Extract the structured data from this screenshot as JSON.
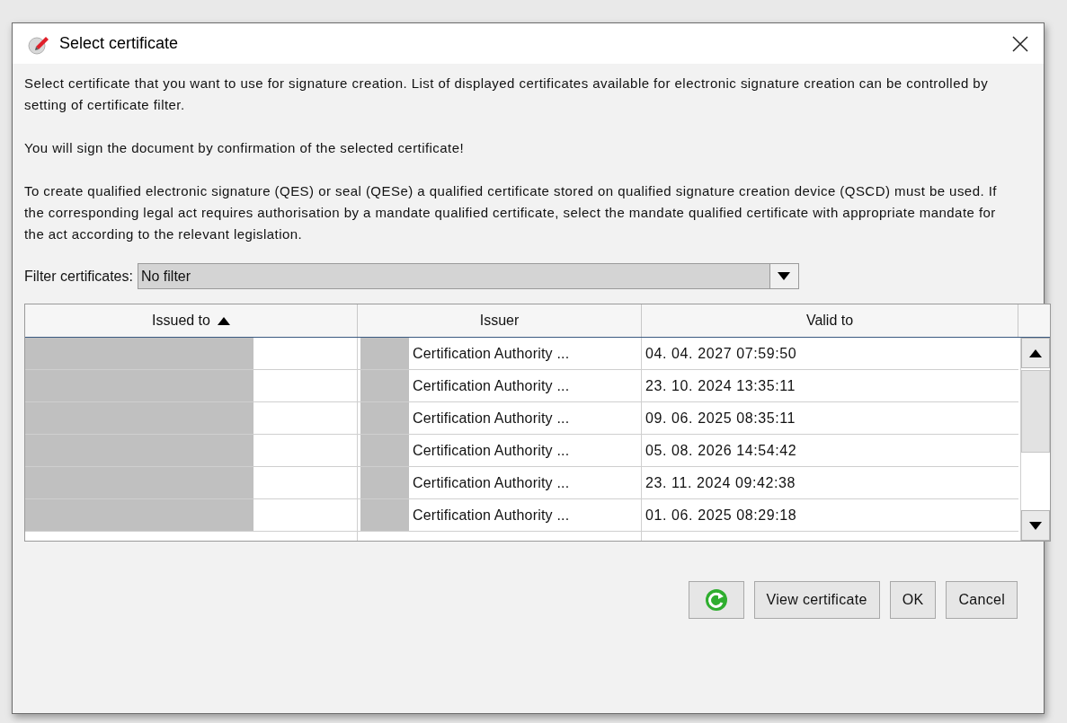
{
  "window": {
    "title": "Select certificate"
  },
  "intro": [
    "Select certificate that you want to use for signature creation. List of displayed certificates available for electronic signature creation can be controlled by setting of certificate filter.",
    "You will sign the document by confirmation of the selected certificate!",
    "To create qualified electronic signature (QES) or seal (QESe) a qualified certificate stored on qualified signature creation device (QSCD) must be used. If the corresponding legal act requires authorisation by a mandate qualified certificate, select the mandate qualified certificate with appropriate mandate for the act according to the relevant legislation."
  ],
  "filter": {
    "label": "Filter certificates:",
    "value": "No filter"
  },
  "table": {
    "columns": [
      {
        "label": "Issued to",
        "sorted": true
      },
      {
        "label": "Issuer",
        "sorted": false
      },
      {
        "label": "Valid to",
        "sorted": false
      }
    ],
    "rows": [
      {
        "redacted": true,
        "issuer": "Certification Authority ...",
        "valid_to": "04. 04. 2027 07:59:50"
      },
      {
        "redacted": true,
        "issuer": "Certification Authority ...",
        "valid_to": "23. 10. 2024 13:35:11"
      },
      {
        "redacted": true,
        "issuer": "Certification Authority ...",
        "valid_to": "09. 06. 2025 08:35:11"
      },
      {
        "redacted": true,
        "issuer": "Certification Authority ...",
        "valid_to": "05. 08. 2026 14:54:42"
      },
      {
        "redacted": true,
        "issuer": "Certification Authority ...",
        "valid_to": "23. 11. 2024 09:42:38"
      },
      {
        "redacted": true,
        "issuer": "Certification Authority ...",
        "valid_to": "01. 06. 2025 08:29:18"
      }
    ]
  },
  "buttons": [
    "View certificate",
    "OK",
    "Cancel"
  ]
}
